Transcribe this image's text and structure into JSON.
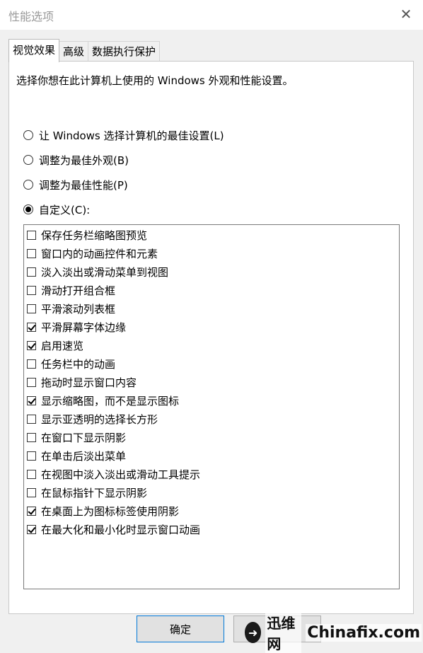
{
  "window": {
    "title": "性能选项",
    "close_glyph": "✕"
  },
  "tabs": [
    {
      "label": "视觉效果",
      "active": true
    },
    {
      "label": "高级",
      "active": false
    },
    {
      "label": "数据执行保护",
      "active": false
    }
  ],
  "description": "选择你想在此计算机上使用的 Windows 外观和性能设置。",
  "radios": [
    {
      "label": "让 Windows 选择计算机的最佳设置(L)",
      "selected": false
    },
    {
      "label": "调整为最佳外观(B)",
      "selected": false
    },
    {
      "label": "调整为最佳性能(P)",
      "selected": false
    },
    {
      "label": "自定义(C):",
      "selected": true
    }
  ],
  "options": [
    {
      "label": "保存任务栏缩略图预览",
      "checked": false
    },
    {
      "label": "窗口内的动画控件和元素",
      "checked": false
    },
    {
      "label": "淡入淡出或滑动菜单到视图",
      "checked": false
    },
    {
      "label": "滑动打开组合框",
      "checked": false
    },
    {
      "label": "平滑滚动列表框",
      "checked": false
    },
    {
      "label": "平滑屏幕字体边缘",
      "checked": true
    },
    {
      "label": "启用速览",
      "checked": true
    },
    {
      "label": "任务栏中的动画",
      "checked": false
    },
    {
      "label": "拖动时显示窗口内容",
      "checked": false
    },
    {
      "label": "显示缩略图，而不是显示图标",
      "checked": true
    },
    {
      "label": "显示亚透明的选择长方形",
      "checked": false
    },
    {
      "label": "在窗口下显示阴影",
      "checked": false
    },
    {
      "label": "在单击后淡出菜单",
      "checked": false
    },
    {
      "label": "在视图中淡入淡出或滑动工具提示",
      "checked": false
    },
    {
      "label": "在鼠标指针下显示阴影",
      "checked": false
    },
    {
      "label": "在桌面上为图标标签使用阴影",
      "checked": true
    },
    {
      "label": "在最大化和最小化时显示窗口动画",
      "checked": true
    }
  ],
  "buttons": {
    "ok": "确定"
  },
  "watermark": {
    "brand": "迅维网",
    "site": "Chinafix.com"
  }
}
